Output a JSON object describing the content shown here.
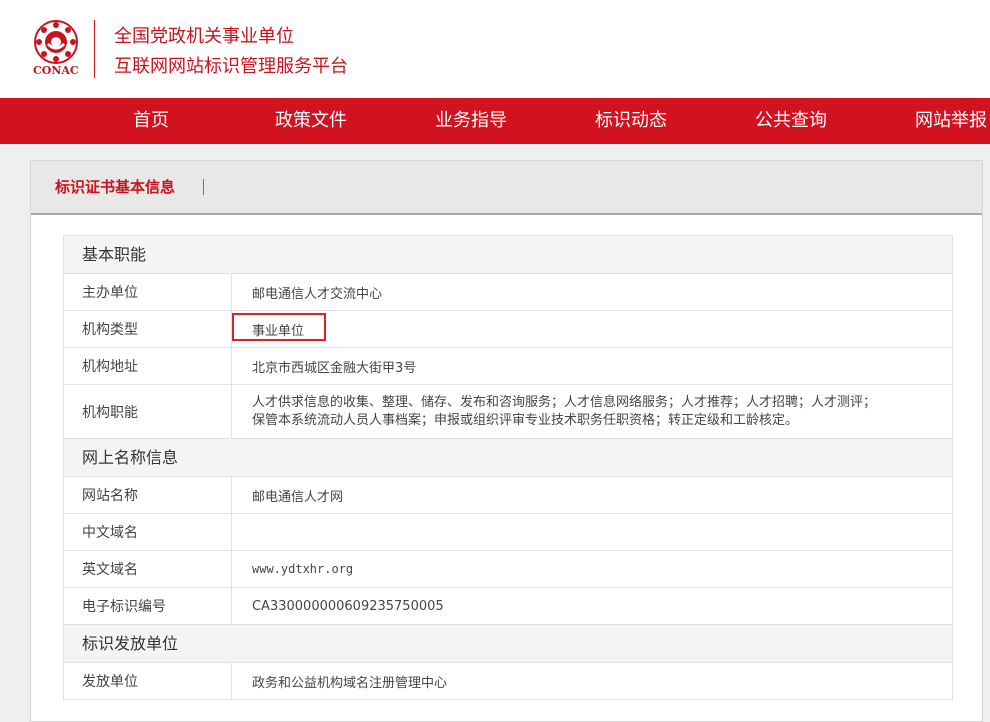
{
  "header": {
    "logo_text": "CONAC",
    "title_line1": "全国党政机关事业单位",
    "title_line2": "互联网网站标识管理服务平台"
  },
  "nav": [
    "首页",
    "政策文件",
    "业务指导",
    "标识动态",
    "公共查询",
    "网站举报"
  ],
  "panel": {
    "title": "标识证书基本信息",
    "sections": {
      "basic": {
        "title": "基本职能",
        "rows": [
          {
            "label": "主办单位",
            "value": "邮电通信人才交流中心"
          },
          {
            "label": "机构类型",
            "value": "事业单位"
          },
          {
            "label": "机构地址",
            "value": "北京市西城区金融大街甲3号"
          },
          {
            "label": "机构职能",
            "value_line1": "人才供求信息的收集、整理、储存、发布和咨询服务；人才信息网络服务；人才推荐；人才招聘；人才测评；",
            "value_line2": "保管本系统流动人员人事档案；申报或组织评审专业技术职务任职资格；转正定级和工龄核定。"
          }
        ]
      },
      "web": {
        "title": "网上名称信息",
        "rows": [
          {
            "label": "网站名称",
            "value": "邮电通信人才网"
          },
          {
            "label": "中文域名",
            "value": ""
          },
          {
            "label": "英文域名",
            "value": "www.ydtxhr.org"
          },
          {
            "label": "电子标识编号",
            "value": "CA33000000060923575000​5"
          }
        ]
      },
      "issuer": {
        "title": "标识发放单位",
        "rows": [
          {
            "label": "发放单位",
            "value": "政务和公益机构域名注册管理中心"
          }
        ]
      }
    }
  },
  "colors": {
    "brand_red": "#d2121e",
    "highlight_border": "#d8222c"
  }
}
